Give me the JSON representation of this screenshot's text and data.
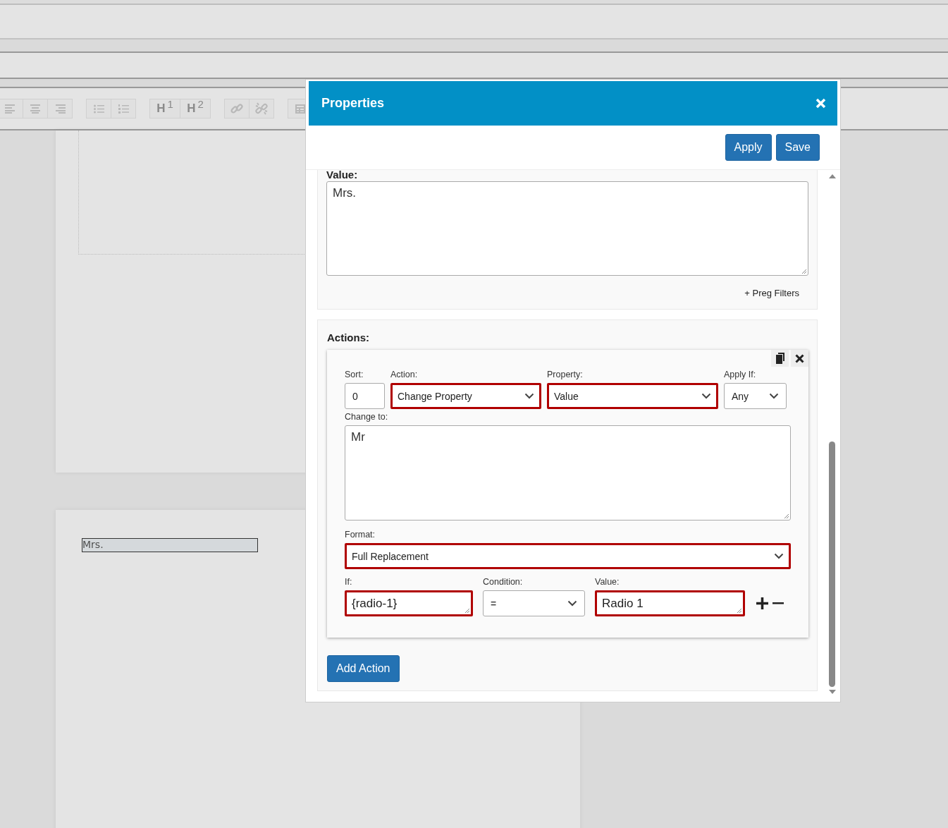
{
  "editor": {
    "toolbar": [
      {
        "items": [
          {
            "kind": "align-left"
          },
          {
            "kind": "align-center"
          },
          {
            "kind": "align-right"
          }
        ]
      },
      {
        "items": [
          {
            "kind": "bullet-list"
          },
          {
            "kind": "numbered-list"
          }
        ]
      },
      {
        "items": [
          {
            "kind": "heading",
            "letter": "H",
            "number": "1"
          },
          {
            "kind": "heading",
            "letter": "H",
            "number": "2"
          }
        ]
      },
      {
        "items": [
          {
            "kind": "link"
          },
          {
            "kind": "unlink"
          }
        ]
      },
      {
        "items": [
          {
            "kind": "table"
          }
        ]
      }
    ],
    "form_field": {
      "value": "Mrs."
    }
  },
  "dialog": {
    "title": "Properties",
    "buttons": [
      "Apply",
      "Save"
    ],
    "value_section": {
      "label": "Value:",
      "value": "Mrs.",
      "link": "+ Preg Filters"
    },
    "actions_section": {
      "label": "Actions:",
      "actions": [
        {
          "fields": [
            {
              "label": "Sort:",
              "value": "0",
              "kind": "input",
              "error": false
            },
            {
              "label": "Action:",
              "value": "Change Property",
              "kind": "select",
              "error": true
            },
            {
              "label": "Property:",
              "value": "Value",
              "kind": "select",
              "error": true
            },
            {
              "label": "Apply If:",
              "value": "Any",
              "kind": "select",
              "error": false
            }
          ],
          "change_to": {
            "label": "Change to:",
            "value": "Mr"
          },
          "format": {
            "label": "Format:",
            "value": "Full Replacement",
            "error": true
          },
          "conditions": [
            {
              "fields": [
                {
                  "label": "If:",
                  "value": "{radio-1}",
                  "kind": "input",
                  "error": true
                },
                {
                  "label": "Condition:",
                  "value": "=",
                  "kind": "select",
                  "error": false
                },
                {
                  "label": "Value:",
                  "value": "Radio 1",
                  "kind": "input",
                  "error": true
                }
              ]
            }
          ]
        }
      ],
      "add_button": "Add Action"
    }
  }
}
